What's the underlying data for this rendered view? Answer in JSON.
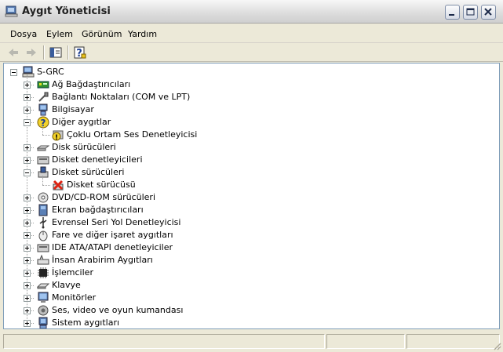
{
  "window": {
    "title": "Aygıt Yöneticisi",
    "title_icon": "computer-management-icon"
  },
  "menu": [
    "Dosya",
    "Eylem",
    "Görünüm",
    "Yardım"
  ],
  "toolbar": [
    "back-arrow-icon",
    "forward-arrow-icon",
    "show-hide-console-tree-icon",
    "properties-help-icon"
  ],
  "tree": {
    "root": "S-GRC",
    "items": [
      {
        "label": "Ağ Bağdaştırıcıları",
        "icon": "network-adapter-icon",
        "state": "collapsed"
      },
      {
        "label": "Bağlantı Noktaları (COM ve LPT)",
        "icon": "port-icon",
        "state": "collapsed"
      },
      {
        "label": "Bilgisayar",
        "icon": "computer-icon",
        "state": "collapsed"
      },
      {
        "label": "Diğer aygıtlar",
        "icon": "unknown-device-icon",
        "state": "expanded",
        "children": [
          {
            "label": "Çoklu Ortam Ses Denetleyicisi",
            "icon": "warning-device-icon"
          }
        ]
      },
      {
        "label": "Disk sürücüleri",
        "icon": "disk-drive-icon",
        "state": "collapsed"
      },
      {
        "label": "Disket denetleyicileri",
        "icon": "floppy-controller-icon",
        "state": "collapsed"
      },
      {
        "label": "Disket sürücüleri",
        "icon": "floppy-drive-icon",
        "state": "expanded",
        "children": [
          {
            "label": "Disket sürücüsü",
            "icon": "disabled-floppy-icon"
          }
        ]
      },
      {
        "label": "DVD/CD-ROM sürücüleri",
        "icon": "cdrom-icon",
        "state": "collapsed"
      },
      {
        "label": "Ekran bağdaştırıcıları",
        "icon": "display-adapter-icon",
        "state": "collapsed"
      },
      {
        "label": "Evrensel Seri Yol Denetleyicisi",
        "icon": "usb-icon",
        "state": "collapsed"
      },
      {
        "label": "Fare ve diğer işaret aygıtları",
        "icon": "mouse-icon",
        "state": "collapsed"
      },
      {
        "label": "IDE ATA/ATAPI denetleyiciler",
        "icon": "ide-controller-icon",
        "state": "collapsed"
      },
      {
        "label": "İnsan Arabirim Aygıtları",
        "icon": "hid-icon",
        "state": "collapsed"
      },
      {
        "label": "İşlemciler",
        "icon": "processor-icon",
        "state": "collapsed"
      },
      {
        "label": "Klavye",
        "icon": "keyboard-icon",
        "state": "collapsed"
      },
      {
        "label": "Monitörler",
        "icon": "monitor-icon",
        "state": "collapsed"
      },
      {
        "label": "Ses, video ve oyun kumandası",
        "icon": "sound-icon",
        "state": "collapsed"
      },
      {
        "label": "Sistem aygıtları",
        "icon": "system-device-icon",
        "state": "collapsed"
      }
    ]
  }
}
